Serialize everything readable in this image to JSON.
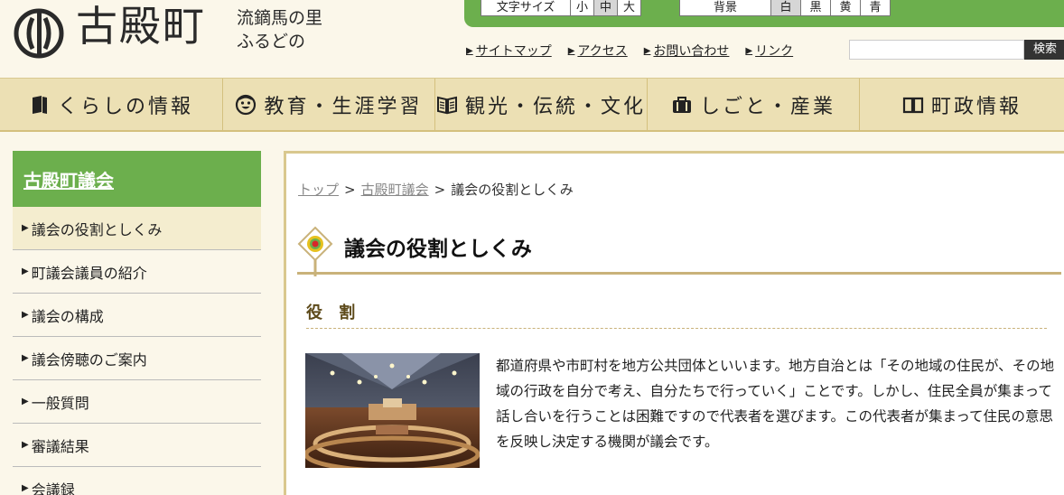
{
  "header": {
    "logo_name": "古殿町",
    "logo_sub_line1": "流鏑馬の里",
    "logo_sub_line2": "ふるどの",
    "font_size": {
      "label": "文字サイズ",
      "options": [
        "小",
        "中",
        "大"
      ],
      "selected": "中"
    },
    "background": {
      "label": "背景",
      "options": [
        "白",
        "黒",
        "黄",
        "青"
      ],
      "selected": "白"
    },
    "links": [
      "サイトマップ",
      "アクセス",
      "お問い合わせ",
      "リンク"
    ],
    "search": {
      "value": "",
      "placeholder": "",
      "button": "検索"
    }
  },
  "gnav": [
    {
      "label": "くらしの情報",
      "icon": "book-icon"
    },
    {
      "label": "教育・生涯学習",
      "icon": "face-icon"
    },
    {
      "label": "観光・伝統・文化",
      "icon": "open-book-icon"
    },
    {
      "label": "しごと・産業",
      "icon": "briefcase-icon"
    },
    {
      "label": "町政情報",
      "icon": "book-open-icon"
    }
  ],
  "sidebar": {
    "heading": "古殿町議会",
    "items": [
      "議会の役割としくみ",
      "町議会議員の紹介",
      "議会の構成",
      "議会傍聴のご案内",
      "一般質問",
      "審議結果",
      "会議録"
    ],
    "active_index": 0
  },
  "breadcrumb": {
    "top": "トップ",
    "parent": "古殿町議会",
    "sep": ">",
    "current": "議会の役割としくみ"
  },
  "main": {
    "title": "議会の役割としくみ",
    "section_heading": "役 割",
    "body": "都道府県や市町村を地方公共団体といいます。地方自治とは「その地域の住民が、その地域の行政を自分で考え、自分たちで行っていく」ことです。しかし、住民全員が集まって話し合いを行うことは困難ですので代表者を選びます。この代表者が集まって住民の意思を反映し決定する機関が議会です。"
  },
  "colors": {
    "accent_green": "#6caf4d",
    "nav_beige": "#ece0b4",
    "page_bg": "#fbf7ea",
    "border_gold": "#c9b27a"
  }
}
